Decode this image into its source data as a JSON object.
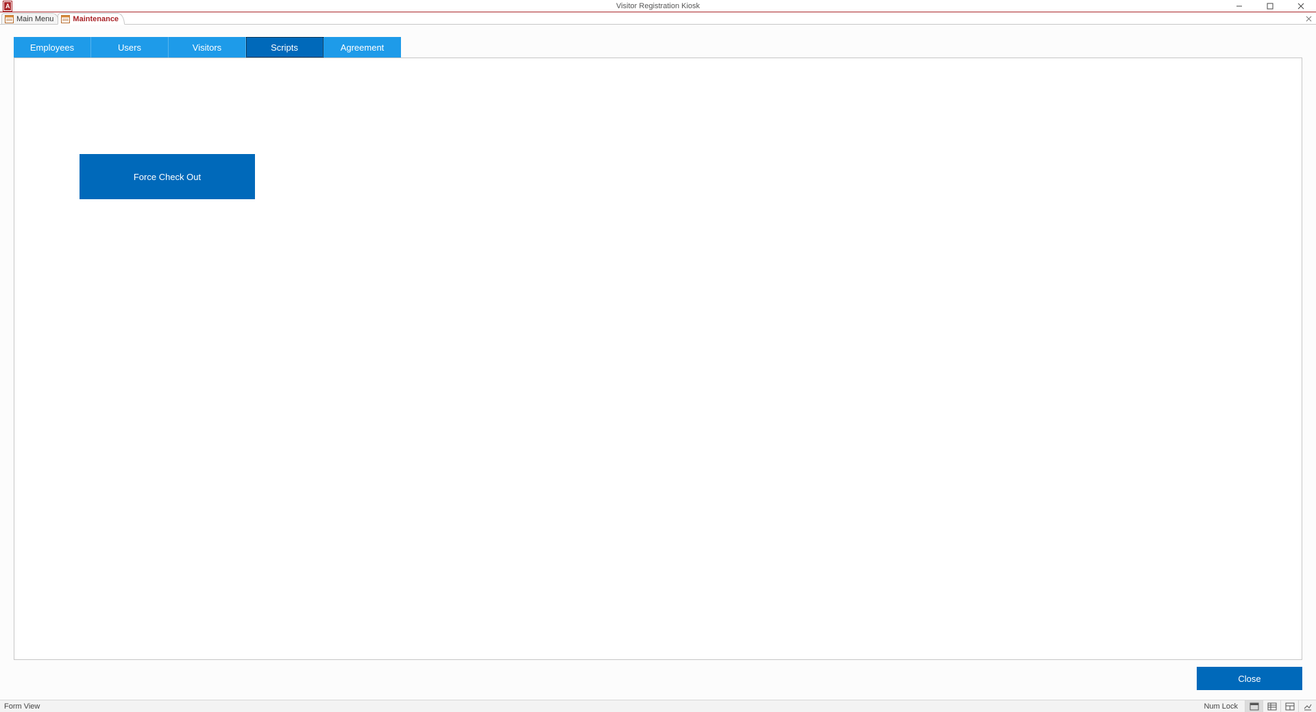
{
  "window": {
    "title": "Visitor Registration Kiosk",
    "app_icon_label": "A"
  },
  "doc_tabs": [
    {
      "label": "Main Menu",
      "active": false
    },
    {
      "label": "Maintenance",
      "active": true
    }
  ],
  "page_tabs": [
    {
      "label": "Employees",
      "selected": false
    },
    {
      "label": "Users",
      "selected": false
    },
    {
      "label": "Visitors",
      "selected": false
    },
    {
      "label": "Scripts",
      "selected": true
    },
    {
      "label": "Agreement",
      "selected": false
    }
  ],
  "scripts_panel": {
    "force_checkout_label": "Force Check Out"
  },
  "footer": {
    "close_label": "Close"
  },
  "statusbar": {
    "view_mode": "Form View",
    "numlock": "Num Lock"
  }
}
